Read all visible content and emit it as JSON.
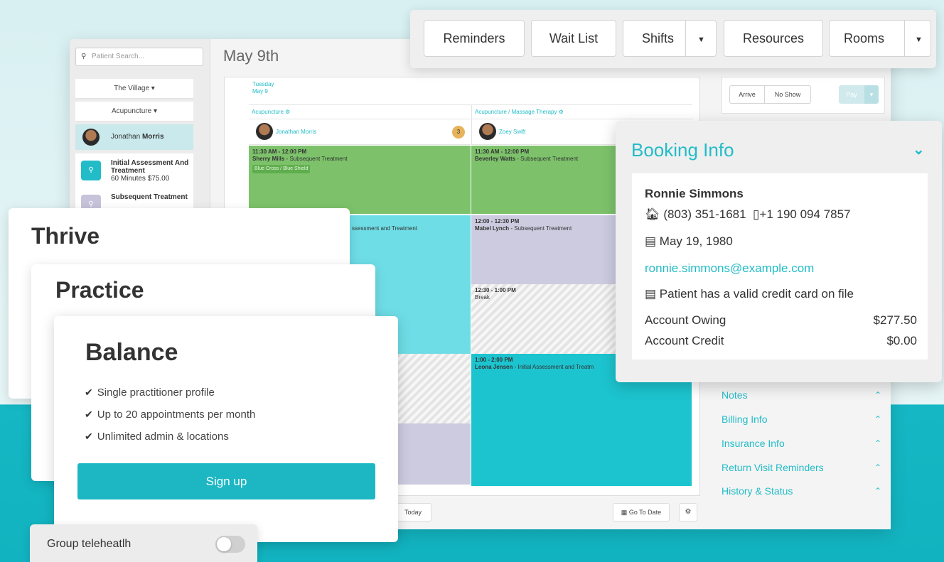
{
  "sidebar": {
    "search_placeholder": "Patient Search...",
    "location": "The Village ▾",
    "discipline": "Acupuncture ▾",
    "practitioner_first": "Jonathan ",
    "practitioner_last": "Morris",
    "services": [
      {
        "name": "Initial Assessment And Treatment",
        "detail": "60 Minutes $75.00"
      },
      {
        "name": "Subsequent Treatment",
        "detail": ""
      }
    ]
  },
  "calendar": {
    "date_title": "May 9th",
    "day_name": "Tuesday",
    "day_date": "May 9",
    "columns": [
      "Acupuncture",
      "Acupuncture / Massage Therapy"
    ],
    "practitioners": [
      "Jonathan Morris",
      "Zoey Swift"
    ],
    "badge": "3",
    "appointments": [
      {
        "time": "11:30 AM - 12:00 PM",
        "patient": "Sherry Mills",
        "service": " - Subsequent Treatment",
        "tag": "Blue Cross / Blue Shield"
      },
      {
        "time": "11:30 AM - 12:00 PM",
        "patient": "Beverley Watts",
        "service": " - Subsequent Treatment"
      },
      {
        "time": "",
        "patient": "",
        "service": "ssessment and Treatment"
      },
      {
        "time": "12:00 - 12:30 PM",
        "patient": "Mabel Lynch",
        "service": " - Subsequent Treatment"
      },
      {
        "time": "12:30 - 1:00 PM",
        "patient": "",
        "service": "Break"
      },
      {
        "time": "1:00 - 2:00 PM",
        "patient": "Leona Jensen",
        "service": " - Initial Assessment and Treatm"
      }
    ],
    "today_label": "Today",
    "go_to_date_label": "Go To Date"
  },
  "actions": {
    "arrive": "Arrive",
    "no_show": "No Show",
    "pay": "Pay"
  },
  "accordion": [
    "Notes",
    "Billing Info",
    "Insurance Info",
    "Return Visit Reminders",
    "History & Status"
  ],
  "toolbar": {
    "reminders": "Reminders",
    "wait_list": "Wait List",
    "shifts": "Shifts",
    "resources": "Resources",
    "rooms": "Rooms"
  },
  "booking": {
    "title": "Booking Info",
    "name": "Ronnie Simmons",
    "home_phone": "(803) 351-1681",
    "mobile_phone": "+1 190 094 7857",
    "dob": "May 19, 1980",
    "email": "ronnie.simmons@example.com",
    "card_status": "Patient has a valid credit card on file",
    "owing_label": "Account Owing",
    "owing_value": "$277.50",
    "credit_label": "Account Credit",
    "credit_value": "$0.00"
  },
  "plans": {
    "thrive": "Thrive",
    "practice": "Practice",
    "balance": "Balance",
    "features": [
      "Single practitioner profile",
      "Up to 20 appointments per month",
      "Unlimited admin & locations"
    ],
    "signup": "Sign up"
  },
  "telehealth": {
    "label": "Group teleheatlh",
    "enabled": false
  },
  "colors": {
    "accent": "#22bcc8",
    "appt_green": "#7dc26b",
    "appt_teal": "#6fdde6",
    "appt_lavender": "#cdcbe0"
  }
}
